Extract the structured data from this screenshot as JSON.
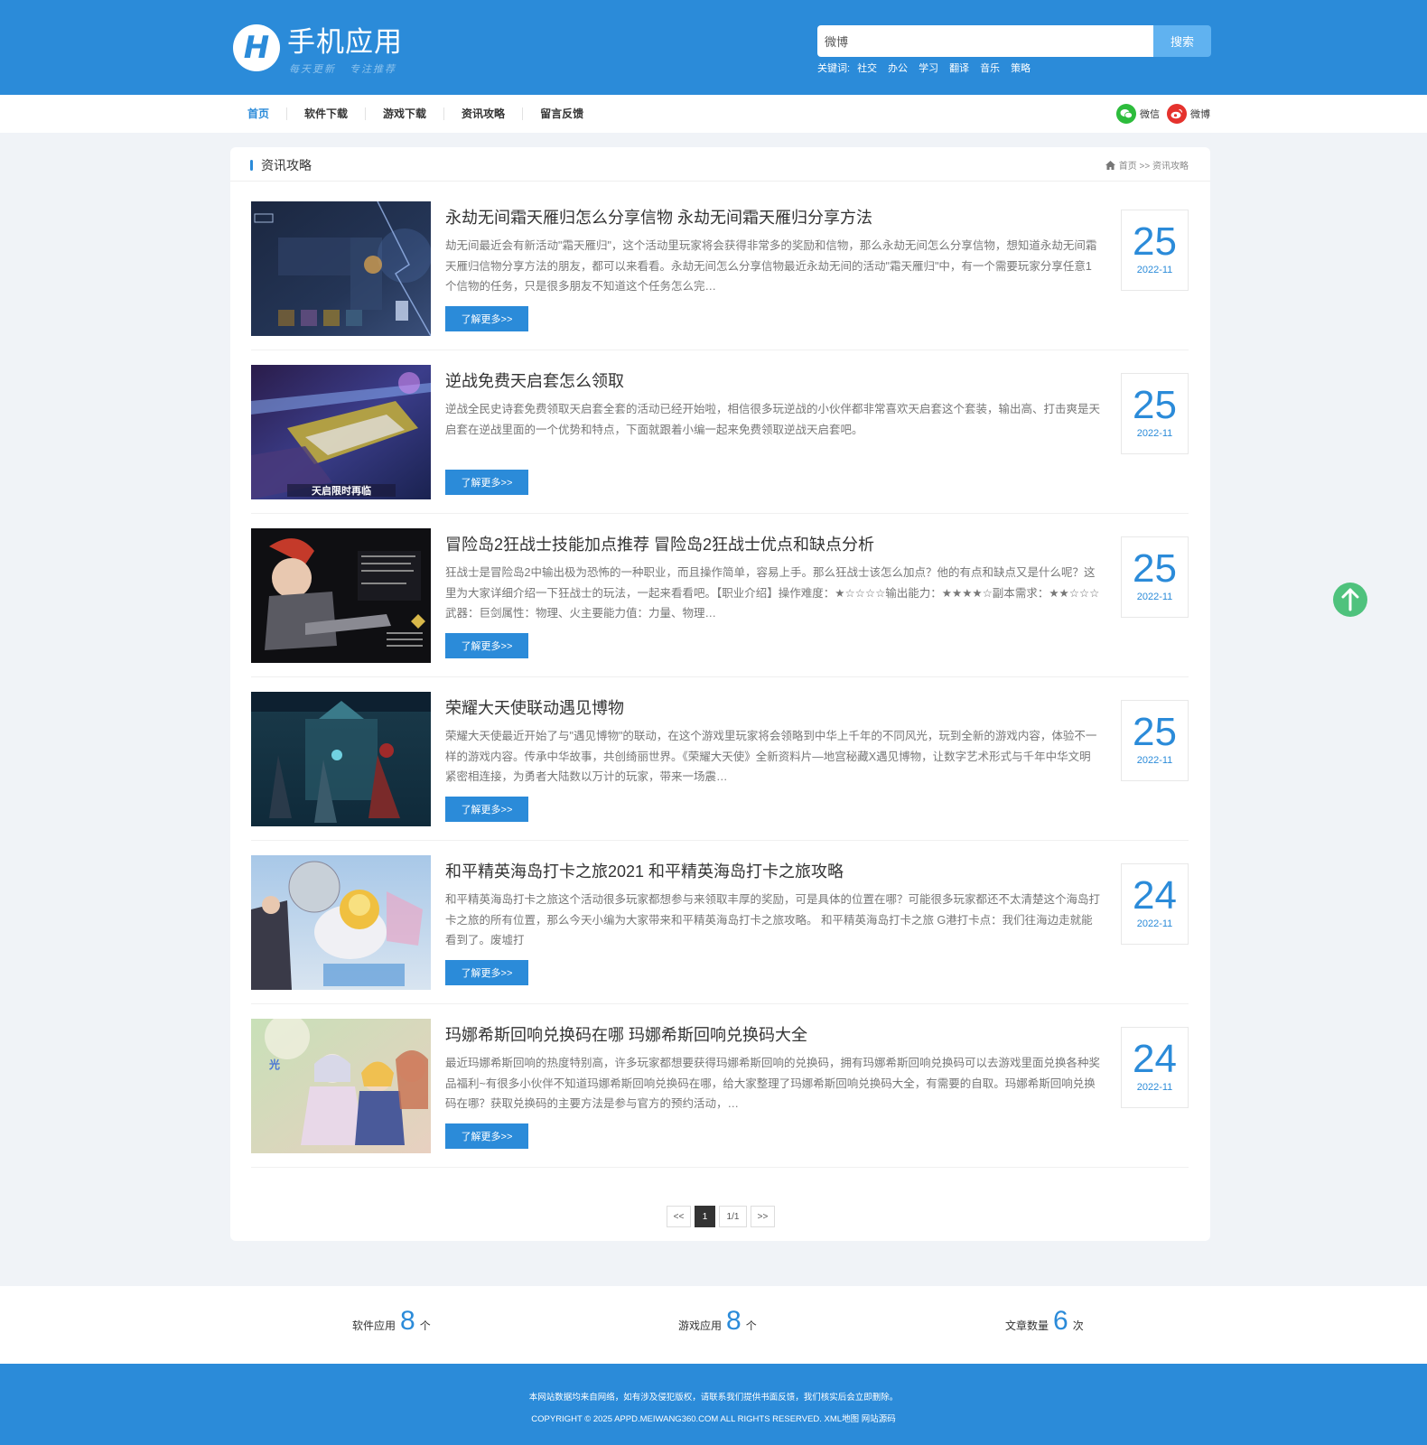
{
  "header": {
    "logo_letter": "H",
    "site_title": "手机应用",
    "site_slogan": "每天更新  专注推荐",
    "search_value": "微博",
    "search_button": "搜索",
    "keywords_label": "关键词:",
    "keywords": [
      "社交",
      "办公",
      "学习",
      "翻译",
      "音乐",
      "策略"
    ]
  },
  "nav": {
    "items": [
      "首页",
      "软件下载",
      "游戏下载",
      "资讯攻略",
      "留言反馈"
    ],
    "active_index": 0,
    "social": [
      "微信",
      "微博"
    ]
  },
  "panel": {
    "title": "资讯攻略",
    "breadcrumb": "首页 >> 资讯攻略"
  },
  "articles": [
    {
      "title": "永劫无间霜天雁归怎么分享信物 永劫无间霜天雁归分享方法",
      "desc": "劫无间最近会有新活动\"霜天雁归\"，这个活动里玩家将会获得非常多的奖励和信物，那么永劫无间怎么分享信物，想知道永劫无间霜天雁归信物分享方法的朋友，都可以来看看。永劫无间怎么分享信物最近永劫无间的活动\"霜天雁归\"中，有一个需要玩家分享任意1个信物的任务，只是很多朋友不知道这个任务怎么完…",
      "more": "了解更多>>",
      "day": "25",
      "ym": "2022-11"
    },
    {
      "title": "逆战免费天启套怎么领取",
      "desc": "逆战全民史诗套免费领取天启套全套的活动已经开始啦，相信很多玩逆战的小伙伴都非常喜欢天启套这个套装，输出高、打击爽是天启套在逆战里面的一个优势和特点，下面就跟着小编一起来免费领取逆战天启套吧。",
      "more": "了解更多>>",
      "day": "25",
      "ym": "2022-11"
    },
    {
      "title": "冒险岛2狂战士技能加点推荐 冒险岛2狂战士优点和缺点分析",
      "desc": "狂战士是冒险岛2中输出极为恐怖的一种职业，而且操作简单，容易上手。那么狂战士该怎么加点？他的有点和缺点又是什么呢？这里为大家详细介绍一下狂战士的玩法，一起来看看吧。【职业介绍】操作难度：★☆☆☆☆输出能力：★★★★☆副本需求：★★☆☆☆武器：巨剑属性：物理、火主要能力值：力量、物理…",
      "more": "了解更多>>",
      "day": "25",
      "ym": "2022-11"
    },
    {
      "title": "荣耀大天使联动遇见博物",
      "desc": "荣耀大天使最近开始了与\"遇见博物\"的联动，在这个游戏里玩家将会领略到中华上千年的不同风光，玩到全新的游戏内容，体验不一样的游戏内容。传承中华故事，共创绮丽世界。《荣耀大天使》全新资料片—地宫秘藏X遇见博物，让数字艺术形式与千年中华文明紧密相连接，为勇者大陆数以万计的玩家，带来一场震…",
      "more": "了解更多>>",
      "day": "25",
      "ym": "2022-11"
    },
    {
      "title": "和平精英海岛打卡之旅2021 和平精英海岛打卡之旅攻略",
      "desc": "和平精英海岛打卡之旅这个活动很多玩家都想参与来领取丰厚的奖励，可是具体的位置在哪？可能很多玩家都还不太清楚这个海岛打卡之旅的所有位置，那么今天小编为大家带来和平精英海岛打卡之旅攻略。 和平精英海岛打卡之旅 G港打卡点：我们往海边走就能看到了。废墟打",
      "more": "了解更多>>",
      "day": "24",
      "ym": "2022-11"
    },
    {
      "title": "玛娜希斯回响兑换码在哪 玛娜希斯回响兑换码大全",
      "desc": "最近玛娜希斯回响的热度特别高，许多玩家都想要获得玛娜希斯回响的兑换码，拥有玛娜希斯回响兑换码可以去游戏里面兑换各种奖品福利~有很多小伙伴不知道玛娜希斯回响兑换码在哪，给大家整理了玛娜希斯回响兑换码大全，有需要的自取。玛娜希斯回响兑换码在哪？获取兑换码的主要方法是参与官方的预约活动，…",
      "more": "了解更多>>",
      "day": "24",
      "ym": "2022-11"
    }
  ],
  "pager": {
    "prev": "<<",
    "current": "1",
    "info": "1/1",
    "next": ">>"
  },
  "stats": [
    {
      "label": "软件应用",
      "value": "8",
      "unit": "个"
    },
    {
      "label": "游戏应用",
      "value": "8",
      "unit": "个"
    },
    {
      "label": "文章数量",
      "value": "6",
      "unit": "次"
    }
  ],
  "footer": {
    "line1": "本网站数据均来自网络，如有涉及侵犯版权，请联系我们提供书面反馈，我们核实后会立即删除。",
    "line2": "COPYRIGHT © 2025 APPD.MEIWANG360.COM ALL RIGHTS RESERVED. XML地图 网站源码"
  },
  "colors": {
    "brand": "#2b8bd9",
    "search_button": "#60b2f0",
    "back_to_top": "#4fc27d",
    "wechat": "#2dbc3c",
    "weibo": "#e5322d"
  },
  "icons": [
    "home-icon",
    "wechat-icon",
    "weibo-icon",
    "arrow-up-icon"
  ]
}
